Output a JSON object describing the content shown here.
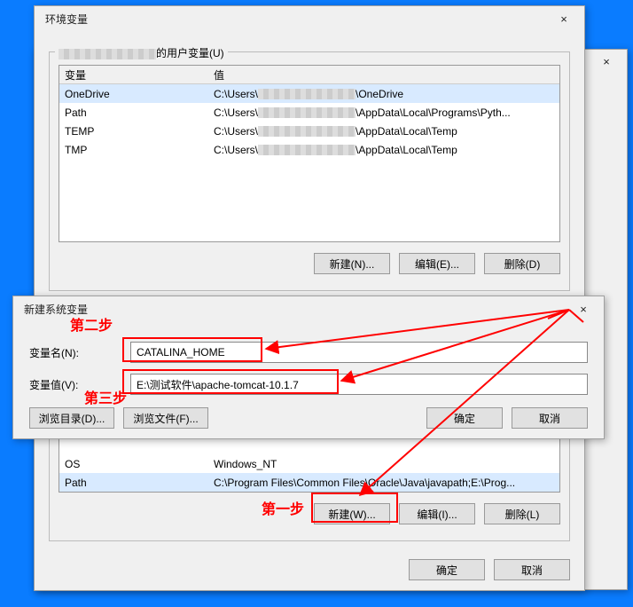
{
  "bg_dialog": {
    "close_x": "×"
  },
  "env_dialog": {
    "title": "环境变量",
    "close_x": "×",
    "user_vars": {
      "legend_prefix_redacted": true,
      "legend_suffix": "的用户变量(U)",
      "header_var": "变量",
      "header_val": "值",
      "rows": [
        {
          "var": "OneDrive",
          "val_pre": "C:\\Users\\",
          "val_post": "\\OneDrive",
          "redacted_mid": true
        },
        {
          "var": "Path",
          "val_pre": "C:\\Users\\",
          "val_post": "\\AppData\\Local\\Programs\\Pyth...",
          "redacted_mid": true
        },
        {
          "var": "TEMP",
          "val_pre": "C:\\Users\\",
          "val_post": "\\AppData\\Local\\Temp",
          "redacted_mid": true
        },
        {
          "var": "TMP",
          "val_pre": "C:\\Users\\",
          "val_post": "\\AppData\\Local\\Temp",
          "redacted_mid": true
        }
      ],
      "btn_new": "新建(N)...",
      "btn_edit": "编辑(E)...",
      "btn_delete": "删除(D)"
    },
    "sys_vars": {
      "rows": [
        {
          "var": "OS",
          "val": "Windows_NT"
        },
        {
          "var": "Path",
          "val": "C:\\Program Files\\Common Files\\Oracle\\Java\\javapath;E:\\Prog..."
        }
      ],
      "btn_new": "新建(W)...",
      "btn_edit": "编辑(I)...",
      "btn_delete": "删除(L)"
    },
    "btn_ok": "确定",
    "btn_cancel": "取消"
  },
  "newvar_dialog": {
    "title": "新建系统变量",
    "close_x": "×",
    "name_label": "变量名(N):",
    "name_value": "CATALINA_HOME",
    "value_label": "变量值(V):",
    "value_value": "E:\\测试软件\\apache-tomcat-10.1.7",
    "btn_browse_dir": "浏览目录(D)...",
    "btn_browse_file": "浏览文件(F)...",
    "btn_ok": "确定",
    "btn_cancel": "取消"
  },
  "annotations": {
    "step1": "第一步",
    "step2": "第二步",
    "step3": "第三步"
  }
}
